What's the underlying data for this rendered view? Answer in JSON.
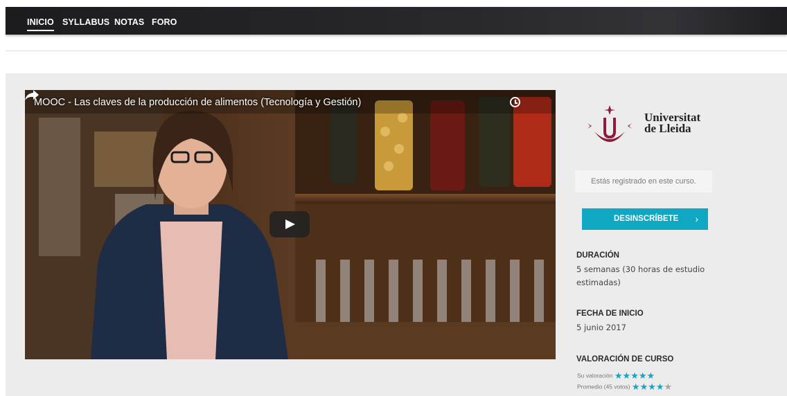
{
  "nav": {
    "items": [
      {
        "label": "INICIO",
        "active": true
      },
      {
        "label": "SYLLABUS",
        "active": false
      },
      {
        "label": "NOTAS",
        "active": false
      },
      {
        "label": "FORO",
        "active": false
      }
    ]
  },
  "video": {
    "title": "MOOC - Las claves de la producción de alimentos (Tecnología y Gestión)",
    "icons": [
      "clock-icon",
      "share-icon",
      "play-icon"
    ]
  },
  "sidebar": {
    "logo": {
      "line1": "Universitat",
      "line2": "de Lleida"
    },
    "registered_text": "Estás registrado en este curso.",
    "unsubscribe_label": "DESINSCRÍBETE",
    "unsubscribe_chevron": "›",
    "duration": {
      "title": "DURACIÓN",
      "text": "5 semanas (30 horas de estudio estimadas)"
    },
    "start_date": {
      "title": "FECHA DE INICIO",
      "text": "5 junio 2017"
    },
    "rating": {
      "title": "VALORACIÓN DE CURSO",
      "user_label": "Su valoración",
      "user_stars": 5,
      "average_label": "Promedio (45 votos)",
      "average_stars": 4
    }
  },
  "colors": {
    "accent": "#0fa7c1",
    "navbar": "#232327",
    "panel": "#ececec"
  }
}
